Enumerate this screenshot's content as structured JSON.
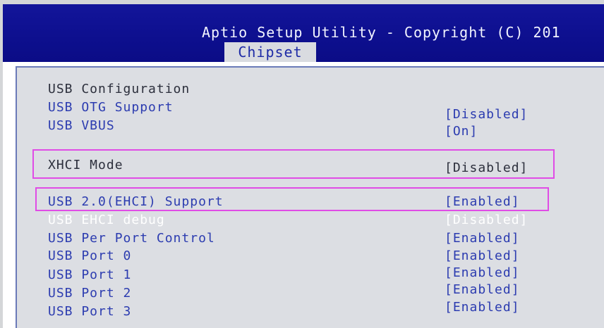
{
  "header": {
    "title": "Aptio Setup Utility - Copyright (C) 201",
    "tab": "Chipset"
  },
  "menu": {
    "rows": [
      {
        "label": "USB Configuration",
        "value": "",
        "color": "#2c2f3c"
      },
      {
        "label": "USB OTG Support",
        "value": "[Disabled]",
        "color": "#2c3cb0"
      },
      {
        "label": "USB VBUS",
        "value": "[On]",
        "color": "#2c3cb0"
      },
      {
        "label": "XHCI Mode",
        "value": "[Disabled]",
        "color": "#2c2f3c"
      },
      {
        "label": "USB 2.0(EHCI) Support",
        "value": "[Enabled]",
        "color": "#2c3cb0"
      },
      {
        "label": "USB EHCI debug",
        "value": "[Disabled]",
        "color": "#ffffff"
      },
      {
        "label": "USB Per Port Control",
        "value": "[Enabled]",
        "color": "#2c3cb0"
      },
      {
        "label": "USB Port 0",
        "value": "[Enabled]",
        "color": "#2c3cb0"
      },
      {
        "label": "USB Port 1",
        "value": "[Enabled]",
        "color": "#2c3cb0"
      },
      {
        "label": "USB Port 2",
        "value": "[Enabled]",
        "color": "#2c3cb0"
      },
      {
        "label": "USB Port 3",
        "value": "[Enabled]",
        "color": "#2c3cb0"
      }
    ]
  },
  "highlight_color": "#e04ce6"
}
